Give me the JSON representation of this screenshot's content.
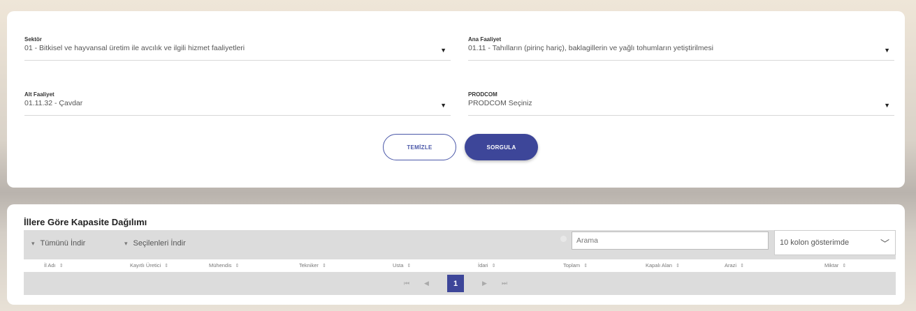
{
  "filters": {
    "sektor": {
      "label": "Sektör",
      "value": "01 - Bitkisel ve hayvansal üretim ile avcılık ve ilgili hizmet faaliyetleri"
    },
    "ana_faaliyet": {
      "label": "Ana Faaliyet",
      "value": "01.11 - Tahılların (pirinç hariç), baklagillerin ve yağlı tohumların yetiştirilmesi"
    },
    "alt_faaliyet": {
      "label": "Alt Faaliyet",
      "value": "01.11.32 - Çavdar"
    },
    "prodcom": {
      "label": "PRODCOM",
      "value": "PRODCOM Seçiniz"
    }
  },
  "buttons": {
    "clear": "TEMİZLE",
    "query": "SORGULA"
  },
  "results": {
    "title": "İllere Göre Kapasite Dağılımı",
    "download_all": "Tümünü İndir",
    "download_selected": "Seçilenleri İndir",
    "search_placeholder": "Arama",
    "column_select": "10 kolon gösterimde",
    "columns": [
      "İl Adı",
      "Kayıtlı Üretici",
      "Mühendis",
      "Tekniker",
      "Usta",
      "İdari",
      "Toplam",
      "Kapalı Alan",
      "Arazi",
      "Miktar"
    ]
  },
  "pagination": {
    "current_page": "1",
    "first": "⏮",
    "prev": "◀",
    "next": "▶",
    "last": "⏭"
  },
  "colors": {
    "accent": "#3d4699",
    "toolbar_bg": "#dcdcdc"
  }
}
